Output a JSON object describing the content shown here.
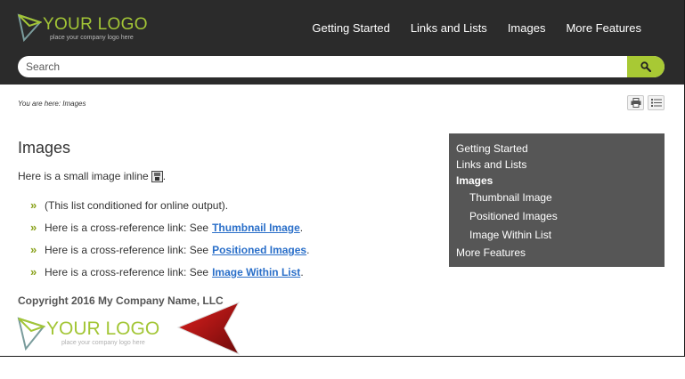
{
  "header": {
    "logo_title": "YOUR LOGO",
    "logo_tagline": "place your company logo here",
    "nav": [
      "Getting Started",
      "Links and Lists",
      "Images",
      "More Features"
    ]
  },
  "search": {
    "placeholder": "Search"
  },
  "breadcrumb": "You are here: Images",
  "main": {
    "title": "Images",
    "intro": "Here is a small image inline",
    "intro_end": ".",
    "list": [
      {
        "text": "(This list conditioned for online output).",
        "link": "",
        "end": ""
      },
      {
        "text": "Here is a cross-reference link: See",
        "link": "Thumbnail Image",
        "end": "."
      },
      {
        "text": "Here is a cross-reference link: See",
        "link": "Positioned Images",
        "end": "."
      },
      {
        "text": "Here is a cross-reference link: See",
        "link": "Image Within List",
        "end": "."
      }
    ],
    "copyright": "Copyright 2016 My Company Name, LLC"
  },
  "footer_logo": {
    "title": "YOUR LOGO",
    "tagline": "place your company logo here"
  },
  "sidebar": {
    "items": [
      {
        "label": "Getting Started"
      },
      {
        "label": "Links and Lists"
      },
      {
        "label": "Images"
      },
      {
        "label": "Thumbnail Image"
      },
      {
        "label": "Positioned Images"
      },
      {
        "label": "Image Within List"
      },
      {
        "label": "More Features"
      }
    ]
  },
  "colors": {
    "header_bg": "#2b2b2b",
    "accent": "#a8c934",
    "link": "#2a6fc9",
    "sidebar_bg": "#565656"
  }
}
